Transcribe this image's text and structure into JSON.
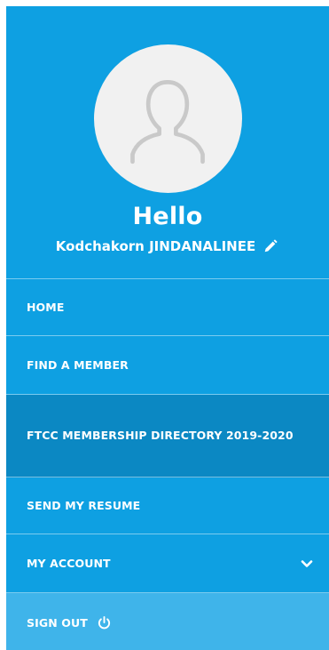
{
  "profile": {
    "greeting": "Hello",
    "user_name": "Kodchakorn JINDANALINEE",
    "avatar_icon": "user-silhouette-icon",
    "edit_icon": "pencil-icon"
  },
  "menu": {
    "items": [
      {
        "label": "HOME"
      },
      {
        "label": "FIND A MEMBER"
      },
      {
        "label": "FTCC MEMBERSHIP DIRECTORY 2019-2020",
        "active": true
      },
      {
        "label": "SEND MY RESUME"
      },
      {
        "label": "MY ACCOUNT",
        "icon": "chevron-down-icon"
      },
      {
        "label": "SIGN OUT",
        "icon": "power-icon"
      }
    ]
  },
  "colors": {
    "drawer_bg": "#0ea0e2",
    "active_bg": "#0b88c3",
    "signout_bg": "#3fb4ea",
    "text": "#ffffff"
  }
}
